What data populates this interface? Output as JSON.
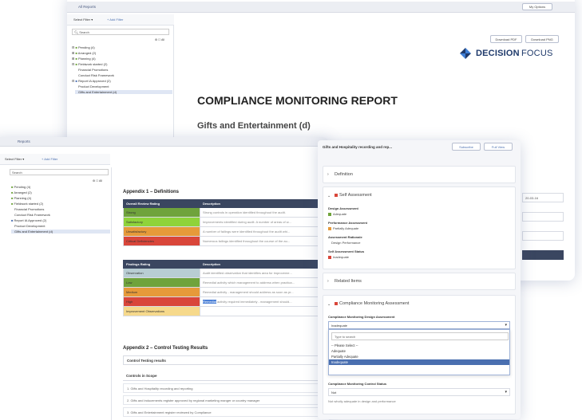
{
  "back_window": {
    "tab_label": "All Reports",
    "top_right_button": "My Options",
    "select_filter": "Select Filter ▾",
    "add_filter": "+ Add Filter",
    "search_placeholder": "Search",
    "select_all": "All",
    "tree": [
      "Pending (4)",
      "Arranged (2)",
      "Planning (4)",
      "Fieldwork started (2)",
      "Financial Promotions",
      "Conduct Risk Framework",
      "Report IA Approved (2)",
      "Product Development",
      "Gifts and Entertainment (d)"
    ],
    "download_pdf": "Download PDF",
    "download_png": "Download PNG",
    "logo_text_bold": "DECISION",
    "logo_text_light": "FOCUS",
    "report_title": "COMPLIANCE MONITORING REPORT",
    "report_subtitle": "Gifts and Entertainment (d)"
  },
  "front_window": {
    "tab_label": "Reports",
    "select_filter": "Select Filter ▾",
    "add_filter": "+ Add Filter",
    "search_placeholder": "Search",
    "select_all": "All",
    "tree": [
      "Pending (4)",
      "Arranged (2)",
      "Planning (4)",
      "Fieldwork started (2)",
      "Financial Promotions",
      "Conduct Risk Framework",
      "Report IA Approved (2)",
      "Product Development",
      "Gifts and Entertainment (d)"
    ],
    "appendix1_title": "Appendix 1 – Definitions",
    "rating_table": {
      "headers": [
        "Overall Review Rating",
        "Description"
      ],
      "rows": [
        {
          "rating": "Strong",
          "color": "#6fa33c",
          "desc": "Strong controls in operation identified throughout the audit."
        },
        {
          "rating": "Satisfactory",
          "color": "#8fd33a",
          "desc": "Improvements identified during audit. A number of areas of w..."
        },
        {
          "rating": "Unsatisfactory",
          "color": "#e69a3a",
          "desc": "A number of failings were identified throughout the audit whi..."
        },
        {
          "rating": "Critical Deficiencies",
          "color": "#d9463a",
          "desc": "Numerous failings identified throughout the course of the au..."
        }
      ]
    },
    "findings_table": {
      "headers": [
        "Findings Rating",
        "Description"
      ],
      "rows": [
        {
          "rating": "Observation",
          "color": "#b8cdd3",
          "desc": "Audit identified observation that identifies area for improveme..."
        },
        {
          "rating": "Low",
          "color": "#6fa33c",
          "desc": "Remedial activity which management to address when practica..."
        },
        {
          "rating": "Medium",
          "color": "#e69a3a",
          "desc": "Remedial activity - management should address as soon as pr..."
        },
        {
          "rating": "High",
          "color": "#d9463a",
          "desc_highlight": "Remedial",
          "desc": " activity required immediately - management should..."
        },
        {
          "rating": "Improvement Observations",
          "color": "#f6d98b",
          "desc": ""
        }
      ]
    },
    "appendix2_title": "Appendix 2 – Control Testing Results",
    "control_header": "Control Testing results",
    "controls_in_scope": "Controls in Scope",
    "controls": [
      "1. Gifts and Hospitality recording and reporting",
      "2. Gifts and inducements register approved by regional marketing manger or country manager",
      "3. Gifts and Entertainment register reviewed by Compliance"
    ]
  },
  "side_panel": {
    "title": "Gifts and Hospitality recording and rep...",
    "subscribe": "Subscribe",
    "full_view": "Full View",
    "definition": "Definition",
    "self_assessment": "Self Assessment",
    "design_assessment_label": "Design Assessment",
    "design_assessment_value": "Adequate",
    "performance_label": "Performance Assessment",
    "performance_value": "Partially Adequate",
    "rationale_label": "Assessment Rationale",
    "rationale_value": "Design  Performance",
    "status_label": "Self Assessment Status",
    "status_value": "Inadequate",
    "related_items": "Related Items",
    "cma_title": "Compliance Monitoring Assessment",
    "cma_design_label": "Compliance Monitoring Design Assessment",
    "cma_design_value": "Inadequate",
    "search_placeholder": "Type to search",
    "options": [
      "-- Please Select --",
      "Adequate",
      "Partially Adequate",
      "Inadequate"
    ],
    "control_status_label": "Compliance Monitoring Control Status",
    "control_status_value": "Not",
    "footnote": "Not wholly adequate in design and performance",
    "right_date": "20-03-16",
    "colors": {
      "adequate": "#6fa33c",
      "partial": "#e69a3a",
      "inadequate": "#d9463a"
    }
  }
}
